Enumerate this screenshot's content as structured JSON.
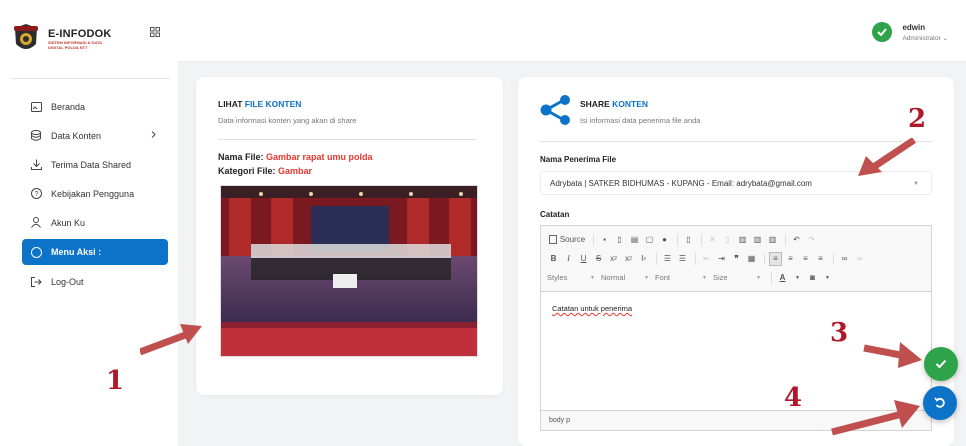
{
  "brand": {
    "title": "E-INFODOK",
    "subtitle": "SISTEM INFORMASI & DATA DIGITAL POLDA NTT"
  },
  "nav": [
    {
      "label": "Beranda",
      "icon": "home-icon"
    },
    {
      "label": "Data Konten",
      "icon": "database-icon",
      "has_children": true
    },
    {
      "label": "Terima Data Shared",
      "icon": "download-icon"
    },
    {
      "label": "Kebijakan Pengguna",
      "icon": "help-icon"
    },
    {
      "label": "Akun Ku",
      "icon": "user-icon"
    },
    {
      "label": "Menu Aksi :",
      "icon": "info-icon",
      "active": true
    },
    {
      "label": "Log-Out",
      "icon": "logout-icon"
    }
  ],
  "user": {
    "name": "edwin",
    "role": "Administrator ⌄"
  },
  "lihat": {
    "title_plain": "LIHAT ",
    "title_accent": "FILE KONTEN",
    "subtitle": "Data informasi konten yang akan di share",
    "file_label": "Nama File: ",
    "file_value": "Gambar rapat umu polda",
    "cat_label": "Kategori File: ",
    "cat_value": "Gambar"
  },
  "share": {
    "title_plain": "SHARE ",
    "title_accent": "KONTEN",
    "subtitle": "Isi informasi data penerima file anda",
    "recipient_label": "Nama Penerima File",
    "recipient_value": "Adrybata | SATKER BIDHUMAS - KUPANG - Email: adrybata@gmail.com",
    "notes_label": "Catatan",
    "notes_text": "Catatan untuk penerima",
    "footer_path": "body  p"
  },
  "toolbar": {
    "source": "Source",
    "styles": "Styles",
    "format": "Normal",
    "font": "Font",
    "size": "Size"
  },
  "annotations": [
    "1",
    "2",
    "3",
    "4"
  ],
  "colors": {
    "accent": "#0d73c8",
    "danger": "#e0392f",
    "success": "#2fa34a",
    "annotation": "#b0182a"
  }
}
